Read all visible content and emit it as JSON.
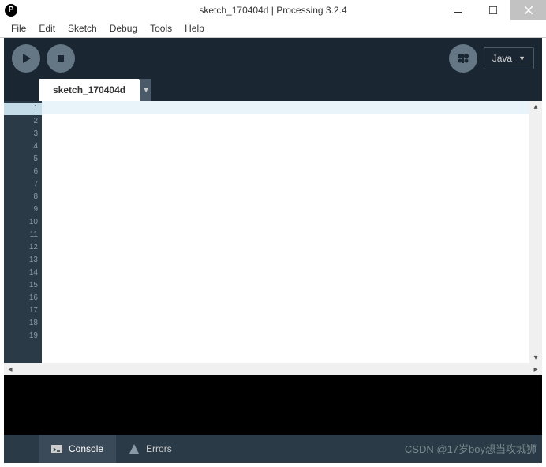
{
  "window": {
    "title": "sketch_170404d | Processing 3.2.4",
    "app_icon_text": "P"
  },
  "menu": {
    "items": [
      "File",
      "Edit",
      "Sketch",
      "Debug",
      "Tools",
      "Help"
    ]
  },
  "toolbar": {
    "mode_label": "Java",
    "mode_arrow": "▼"
  },
  "tabs": {
    "active": "sketch_170404d",
    "drop_arrow": "▼"
  },
  "editor": {
    "line_count": 19
  },
  "status": {
    "console_label": "Console",
    "errors_label": "Errors"
  },
  "watermark": "CSDN @17岁boy想当攻城狮"
}
